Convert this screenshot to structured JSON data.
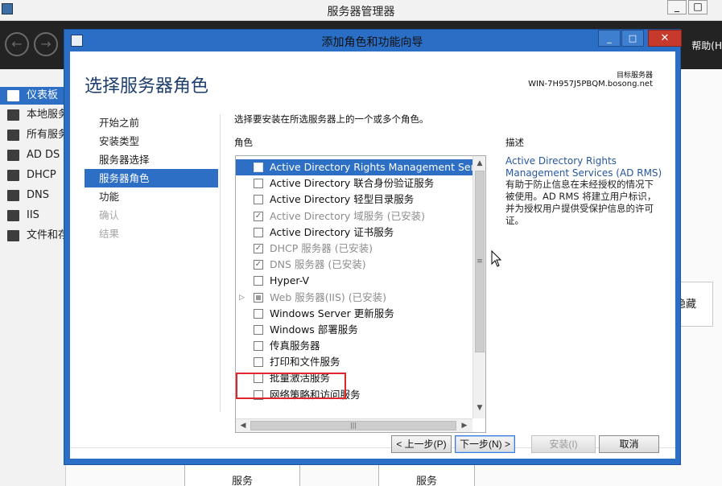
{
  "background_app": {
    "title": "服务器管理器",
    "window_controls": [
      "_",
      "□"
    ],
    "help_label": "帮助(H",
    "sidebar_items": [
      {
        "label": "仪表板",
        "icon": "dashboard-icon",
        "active": true
      },
      {
        "label": "本地服务器",
        "icon": "server-icon"
      },
      {
        "label": "所有服务器",
        "icon": "servers-icon"
      },
      {
        "label": "AD DS",
        "icon": "ad-ds-icon"
      },
      {
        "label": "DHCP",
        "icon": "dhcp-icon"
      },
      {
        "label": "DNS",
        "icon": "dns-icon"
      },
      {
        "label": "IIS",
        "icon": "iis-icon"
      },
      {
        "label": "文件和存储服务",
        "icon": "file-storage-icon"
      }
    ],
    "hide_label": "隐藏",
    "tiles": [
      "服务",
      "服务"
    ]
  },
  "wizard": {
    "title": "添加角色和功能向导",
    "controls": {
      "minimize": "_",
      "maximize": "□",
      "close": "✕"
    },
    "heading": "选择服务器角色",
    "target_label": "目标服务器",
    "target_server": "WIN-7H957J5PBQM.bosong.net",
    "steps": [
      {
        "label": "开始之前",
        "state": "normal"
      },
      {
        "label": "安装类型",
        "state": "normal"
      },
      {
        "label": "服务器选择",
        "state": "normal"
      },
      {
        "label": "服务器角色",
        "state": "active"
      },
      {
        "label": "功能",
        "state": "normal"
      },
      {
        "label": "确认",
        "state": "disabled"
      },
      {
        "label": "结果",
        "state": "disabled"
      }
    ],
    "instruction": "选择要安装在所选服务器上的一个或多个角色。",
    "roles_header": "角色",
    "roles": [
      {
        "label": "Active Directory Rights Management Services",
        "checked": false,
        "installed": false,
        "selected": true
      },
      {
        "label": "Active Directory 联合身份验证服务",
        "checked": false,
        "installed": false
      },
      {
        "label": "Active Directory 轻型目录服务",
        "checked": false,
        "installed": false
      },
      {
        "label": "Active Directory 域服务 (已安装)",
        "checked": true,
        "installed": true
      },
      {
        "label": "Active Directory 证书服务",
        "checked": false,
        "installed": false
      },
      {
        "label": "DHCP 服务器 (已安装)",
        "checked": true,
        "installed": true
      },
      {
        "label": "DNS 服务器 (已安装)",
        "checked": true,
        "installed": true
      },
      {
        "label": "Hyper-V",
        "checked": false,
        "installed": false
      },
      {
        "label": "Web 服务器(IIS) (已安装)",
        "checked": "partial",
        "installed": true,
        "expandable": true
      },
      {
        "label": "Windows Server 更新服务",
        "checked": false,
        "installed": false
      },
      {
        "label": "Windows 部署服务",
        "checked": false,
        "installed": false
      },
      {
        "label": "传真服务器",
        "checked": false,
        "installed": false
      },
      {
        "label": "打印和文件服务",
        "checked": false,
        "installed": false,
        "highlighted": true
      },
      {
        "label": "批量激活服务",
        "checked": false,
        "installed": false
      },
      {
        "label": "网络策略和访问服务",
        "checked": false,
        "installed": false
      }
    ],
    "description_header": "描述",
    "description_title": "Active Directory Rights Management Services (AD RMS)",
    "description_body": "有助于防止信息在未经授权的情况下被使用。AD RMS 将建立用户标识，并为授权用户提供受保护信息的许可证。",
    "buttons": {
      "previous": "< 上一步(P)",
      "next": "下一步(N) >",
      "install": "安装(I)",
      "cancel": "取消"
    }
  }
}
